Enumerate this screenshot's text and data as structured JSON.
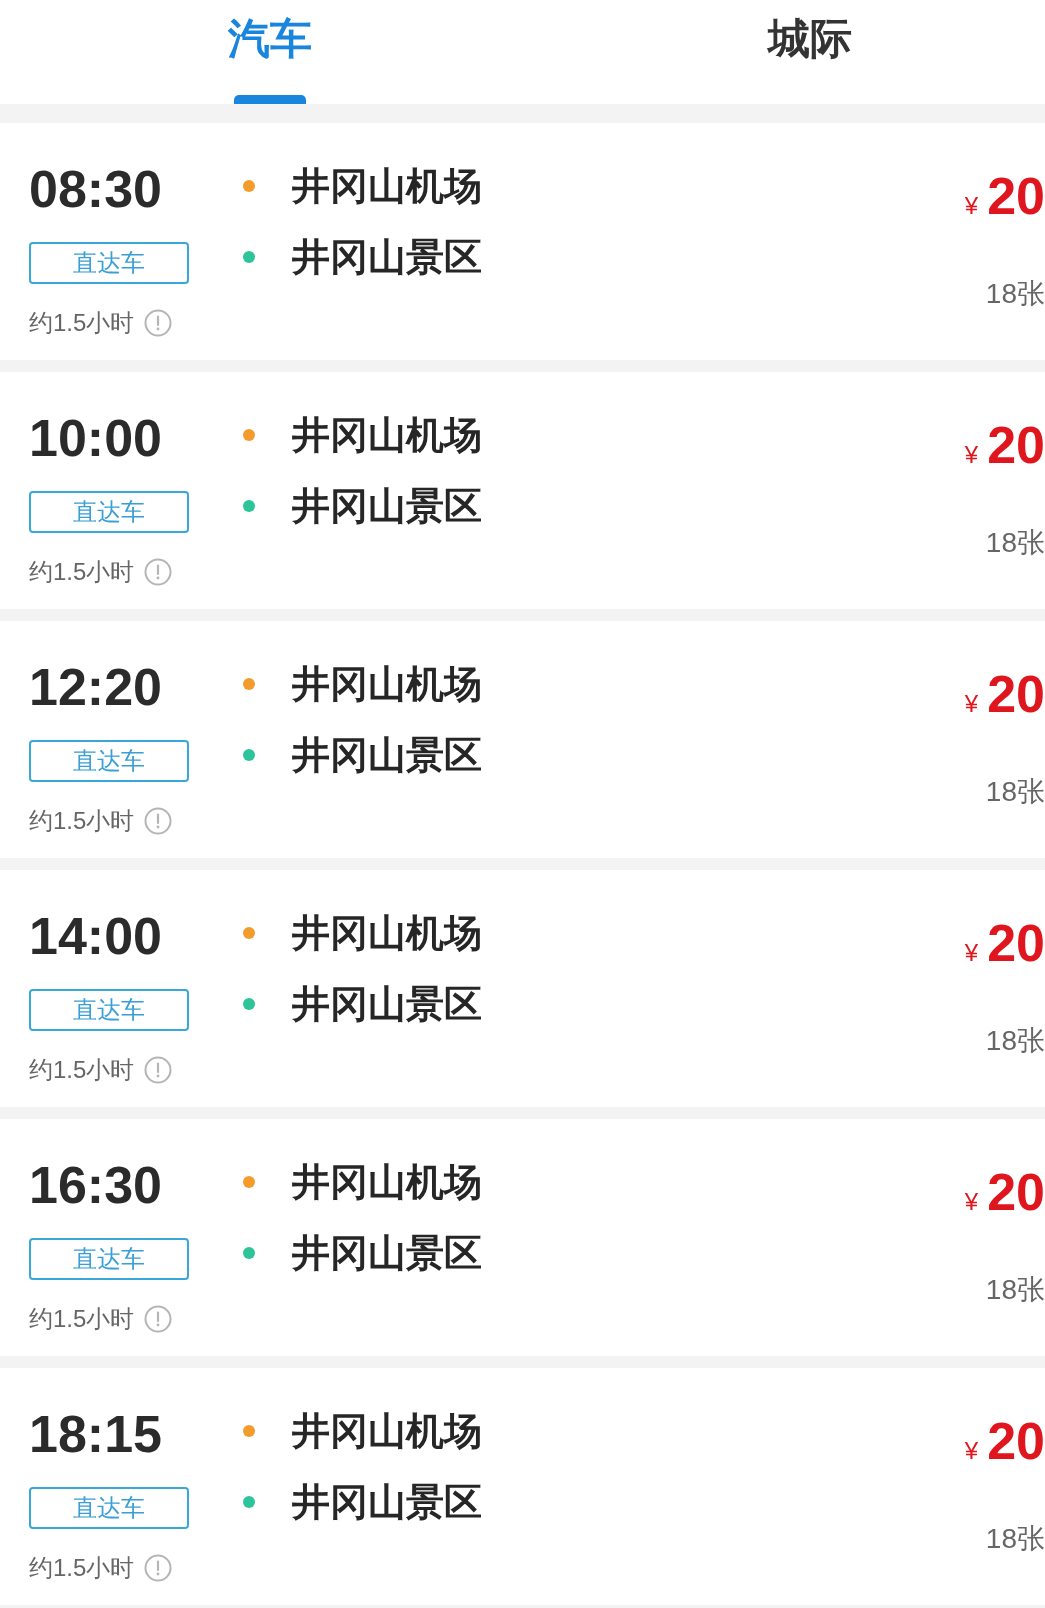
{
  "tabs": [
    {
      "label": "汽车",
      "selected": true
    },
    {
      "label": "城际",
      "selected": false
    }
  ],
  "trips": [
    {
      "time": "08:30",
      "badge": "直达车",
      "duration": "约1.5小时",
      "stops": [
        {
          "name": "井冈山机场",
          "color": "#f39c2b"
        },
        {
          "name": "井冈山景区",
          "color": "#2ec49a"
        }
      ],
      "currency": "¥",
      "price": "20",
      "tickets": "18张"
    },
    {
      "time": "10:00",
      "badge": "直达车",
      "duration": "约1.5小时",
      "stops": [
        {
          "name": "井冈山机场",
          "color": "#f39c2b"
        },
        {
          "name": "井冈山景区",
          "color": "#2ec49a"
        }
      ],
      "currency": "¥",
      "price": "20",
      "tickets": "18张"
    },
    {
      "time": "12:20",
      "badge": "直达车",
      "duration": "约1.5小时",
      "stops": [
        {
          "name": "井冈山机场",
          "color": "#f39c2b"
        },
        {
          "name": "井冈山景区",
          "color": "#2ec49a"
        }
      ],
      "currency": "¥",
      "price": "20",
      "tickets": "18张"
    },
    {
      "time": "14:00",
      "badge": "直达车",
      "duration": "约1.5小时",
      "stops": [
        {
          "name": "井冈山机场",
          "color": "#f39c2b"
        },
        {
          "name": "井冈山景区",
          "color": "#2ec49a"
        }
      ],
      "currency": "¥",
      "price": "20",
      "tickets": "18张"
    },
    {
      "time": "16:30",
      "badge": "直达车",
      "duration": "约1.5小时",
      "stops": [
        {
          "name": "井冈山机场",
          "color": "#f39c2b"
        },
        {
          "name": "井冈山景区",
          "color": "#2ec49a"
        }
      ],
      "currency": "¥",
      "price": "20",
      "tickets": "18张"
    },
    {
      "time": "18:15",
      "badge": "直达车",
      "duration": "约1.5小时",
      "stops": [
        {
          "name": "井冈山机场",
          "color": "#f39c2b"
        },
        {
          "name": "井冈山景区",
          "color": "#2ec49a"
        }
      ],
      "currency": "¥",
      "price": "20",
      "tickets": "18张"
    }
  ]
}
